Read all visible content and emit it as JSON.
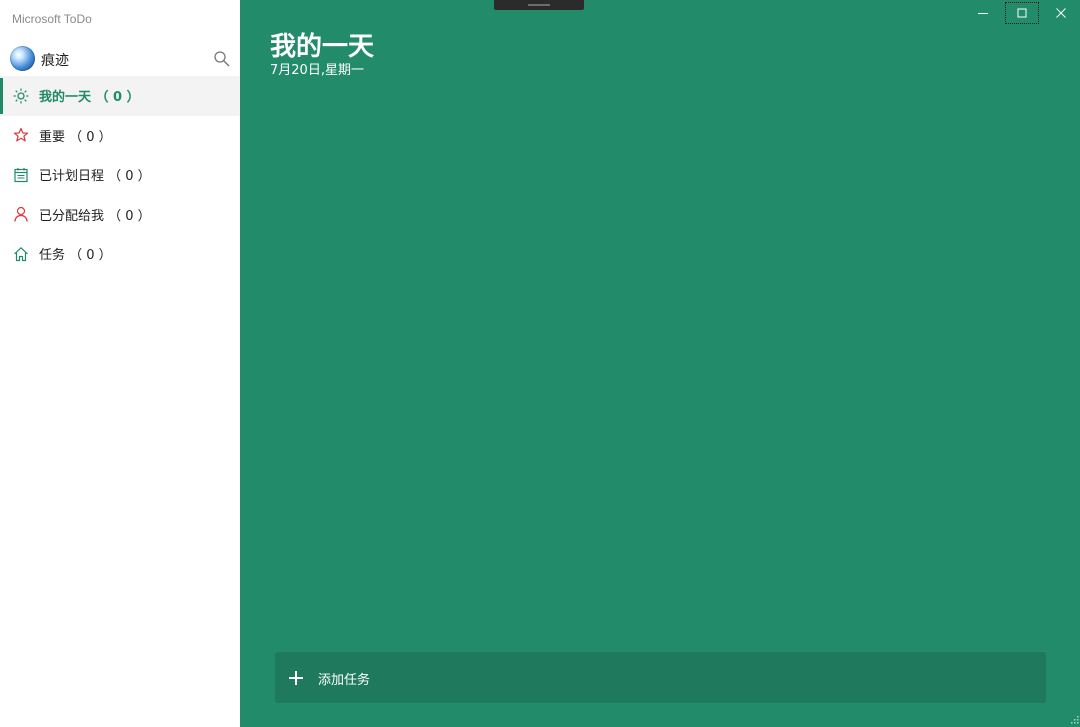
{
  "app": {
    "title": "Microsoft ToDo"
  },
  "user": {
    "name": "痕迹"
  },
  "sidebar": {
    "items": [
      {
        "label": "我的一天 （ 0 ）",
        "icon": "sun-icon",
        "active": true
      },
      {
        "label": "重要 （ 0 ）",
        "icon": "star-icon",
        "active": false
      },
      {
        "label": "已计划日程 （ 0 ）",
        "icon": "calendar-icon",
        "active": false
      },
      {
        "label": "已分配给我 （ 0 ）",
        "icon": "person-icon",
        "active": false
      },
      {
        "label": "任务 （ 0 ）",
        "icon": "home-icon",
        "active": false
      }
    ]
  },
  "main": {
    "title": "我的一天",
    "date": "7月20日,星期一",
    "add_task_label": "添加任务"
  },
  "colors": {
    "accent": "#208a68",
    "main_background": "#228b69",
    "add_task_background": "#1f7a5d",
    "star_icon": "#e0353a",
    "person_icon": "#e0353a"
  }
}
